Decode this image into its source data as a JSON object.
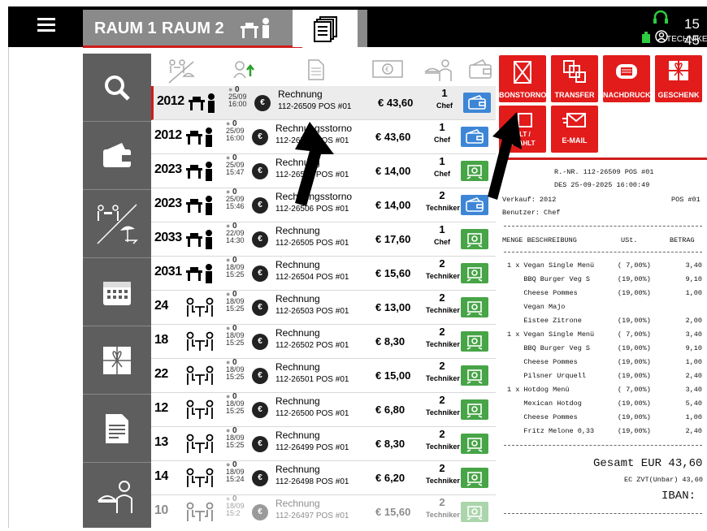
{
  "header": {
    "tab1": "RAUM 1",
    "tab2": "RAUM 2",
    "clock": "15 45",
    "user": "TECHNIKER"
  },
  "rows": [
    {
      "num": "2012",
      "type": "waiter",
      "guests": "0",
      "date": "25/09",
      "time": "16:00",
      "doc": "Rechnung",
      "ref": "112-26509 POS #01",
      "amt": "€ 43,60",
      "cnt": "1",
      "who": "Chef",
      "pay": "blue"
    },
    {
      "num": "2012",
      "type": "waiter",
      "guests": "0",
      "date": "25/09",
      "time": "16:00",
      "doc": "Rechnungsstorno",
      "ref": "112-26508 POS #01",
      "amt": "€ 43,60",
      "cnt": "1",
      "who": "Chef",
      "pay": "blue"
    },
    {
      "num": "2023",
      "type": "waiter",
      "guests": "0",
      "date": "25/09",
      "time": "15:47",
      "doc": "Rechnung",
      "ref": "112-26507 POS #01",
      "amt": "€ 14,00",
      "cnt": "1",
      "who": "Chef",
      "pay": "green"
    },
    {
      "num": "2023",
      "type": "waiter",
      "guests": "0",
      "date": "25/09",
      "time": "15:46",
      "doc": "Rechnungsstorno",
      "ref": "112-26506 POS #01",
      "amt": "€ 14,00",
      "cnt": "2",
      "who": "Techniker",
      "pay": "blue"
    },
    {
      "num": "2033",
      "type": "waiter",
      "guests": "0",
      "date": "22/09",
      "time": "14:30",
      "doc": "Rechnung",
      "ref": "112-26505 POS #01",
      "amt": "€ 17,60",
      "cnt": "1",
      "who": "Chef",
      "pay": "green"
    },
    {
      "num": "2031",
      "type": "waiter",
      "guests": "0",
      "date": "18/09",
      "time": "15:25",
      "doc": "Rechnung",
      "ref": "112-26504 POS #01",
      "amt": "€ 15,60",
      "cnt": "2",
      "who": "Techniker",
      "pay": "green"
    },
    {
      "num": "24",
      "type": "table",
      "guests": "0",
      "date": "18/09",
      "time": "15:25",
      "doc": "Rechnung",
      "ref": "112-26503 POS #01",
      "amt": "€ 13,00",
      "cnt": "2",
      "who": "Techniker",
      "pay": "green"
    },
    {
      "num": "18",
      "type": "table",
      "guests": "0",
      "date": "18/09",
      "time": "15:25",
      "doc": "Rechnung",
      "ref": "112-26502 POS #01",
      "amt": "€ 8,30",
      "cnt": "2",
      "who": "Techniker",
      "pay": "green"
    },
    {
      "num": "22",
      "type": "table",
      "guests": "0",
      "date": "18/09",
      "time": "15:25",
      "doc": "Rechnung",
      "ref": "112-26501 POS #01",
      "amt": "€ 15,00",
      "cnt": "2",
      "who": "Techniker",
      "pay": "green"
    },
    {
      "num": "12",
      "type": "table",
      "guests": "0",
      "date": "18/09",
      "time": "15:25",
      "doc": "Rechnung",
      "ref": "112-26500 POS #01",
      "amt": "€ 6,80",
      "cnt": "2",
      "who": "Techniker",
      "pay": "green"
    },
    {
      "num": "13",
      "type": "table",
      "guests": "0",
      "date": "18/09",
      "time": "15:25",
      "doc": "Rechnung",
      "ref": "112-26499 POS #01",
      "amt": "€ 8,30",
      "cnt": "2",
      "who": "Techniker",
      "pay": "green"
    },
    {
      "num": "14",
      "type": "table",
      "guests": "0",
      "date": "18/09",
      "time": "15:24",
      "doc": "Rechnung",
      "ref": "112-26498 POS #01",
      "amt": "€ 6,20",
      "cnt": "2",
      "who": "Techniker",
      "pay": "green"
    },
    {
      "num": "10",
      "type": "table",
      "guests": "0",
      "date": "18/09",
      "time": "15:2",
      "doc": "Rechnung",
      "ref": "112-26497 POS #01",
      "amt": "€ 15,60",
      "cnt": "2",
      "who": "Techniker",
      "pay": "green"
    }
  ],
  "actions": {
    "bonstorno": "BONSTORNO",
    "transfer": "TRANSFER",
    "nachdruck": "NACHDRUCK",
    "geschenk": "GESCHENK",
    "bezahlt1": "ALT /",
    "bezahlt2": "EZAHLT",
    "email": "E-MAIL"
  },
  "receipt": {
    "l1": "R.-NR. 112-26509 POS #01",
    "l2": "DES 25-09-2025 16:00:49",
    "verkauf": "Verkauf: 2012",
    "pos": "POS #01",
    "benutzer": "Benutzer: Chef",
    "h_menge": "MENGE BESCHREIBUNG",
    "h_ust": "USt.",
    "h_betrag": "BETRAG",
    "items": [
      {
        "d": "1 x Vegan Single Menü",
        "u": "( 7,00%)",
        "b": "3,40"
      },
      {
        "d": "    BBQ Burger Veg S",
        "u": "(19,00%)",
        "b": "9,10"
      },
      {
        "d": "    Cheese Pommes",
        "u": "(19,00%)",
        "b": "1,00"
      },
      {
        "d": "    Vegan Majo",
        "u": "",
        "b": ""
      },
      {
        "d": "    Eistee Zitrone",
        "u": "(19,00%)",
        "b": "2,00"
      },
      {
        "d": "1 x Vegan Single Menü",
        "u": "( 7,00%)",
        "b": "3,40"
      },
      {
        "d": "    BBQ Burger Veg S",
        "u": "(19,00%)",
        "b": "9,10"
      },
      {
        "d": "    Cheese Pommes",
        "u": "(19,00%)",
        "b": "1,00"
      },
      {
        "d": "    Pilsner Urquell",
        "u": "(19,00%)",
        "b": "2,40"
      },
      {
        "d": "1 x Hotdog Menü",
        "u": "( 7,00%)",
        "b": "3,40"
      },
      {
        "d": "    Mexican Hotdog",
        "u": "(19,00%)",
        "b": "5,40"
      },
      {
        "d": "    Cheese Pommes",
        "u": "(19,00%)",
        "b": "1,00"
      },
      {
        "d": "    Fritz Melone 0,33",
        "u": "(19,00%)",
        "b": "2,40"
      }
    ],
    "gesamt": "Gesamt EUR 43,60",
    "ec": "EC ZVT(Unbar) 43,60",
    "iban": "IBAN:"
  },
  "colors": {
    "accent": "#e21b1b",
    "sidebar": "#5e5e5e",
    "pay_blue": "#3d86d6",
    "pay_green": "#47a447"
  }
}
